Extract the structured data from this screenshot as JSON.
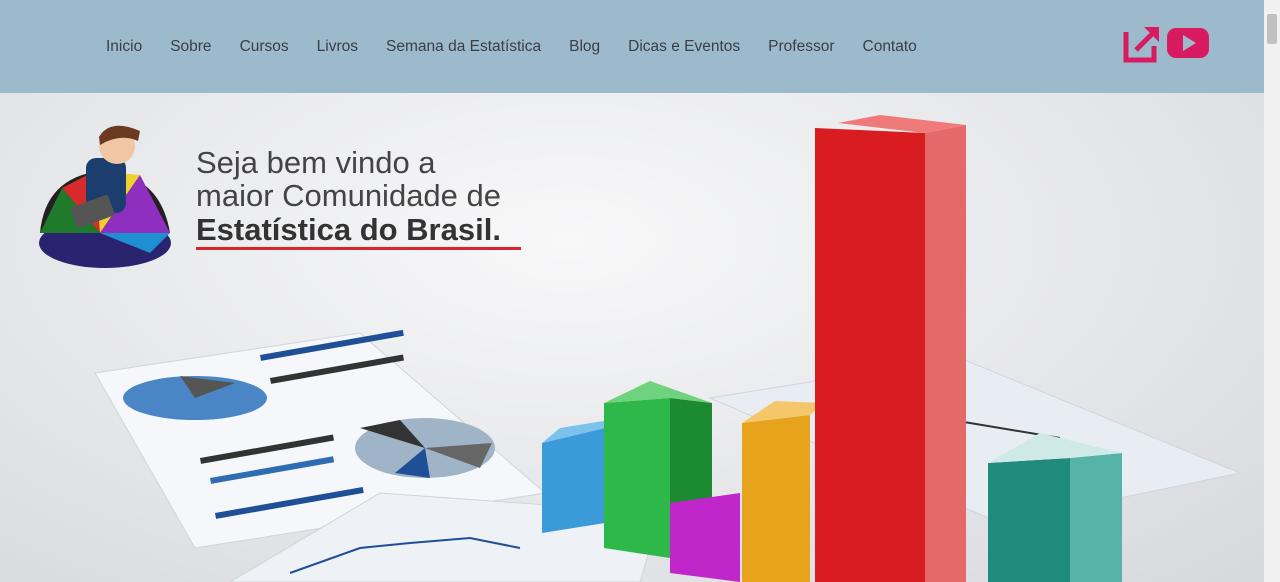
{
  "nav": {
    "items": [
      "Inicio",
      "Sobre",
      "Cursos",
      "Livros",
      "Semana da Estatística",
      "Blog",
      "Dicas e Eventos",
      "Professor",
      "Contato"
    ]
  },
  "header_icons": [
    "external-link-icon",
    "youtube-icon"
  ],
  "hero": {
    "line1": "Seja bem vindo a",
    "line2": "maior Comunidade de",
    "line3": "Estatística do Brasil."
  },
  "colors": {
    "topbar": "#9dbacd",
    "accent": "#d81b60",
    "underline": "#d9262c"
  }
}
